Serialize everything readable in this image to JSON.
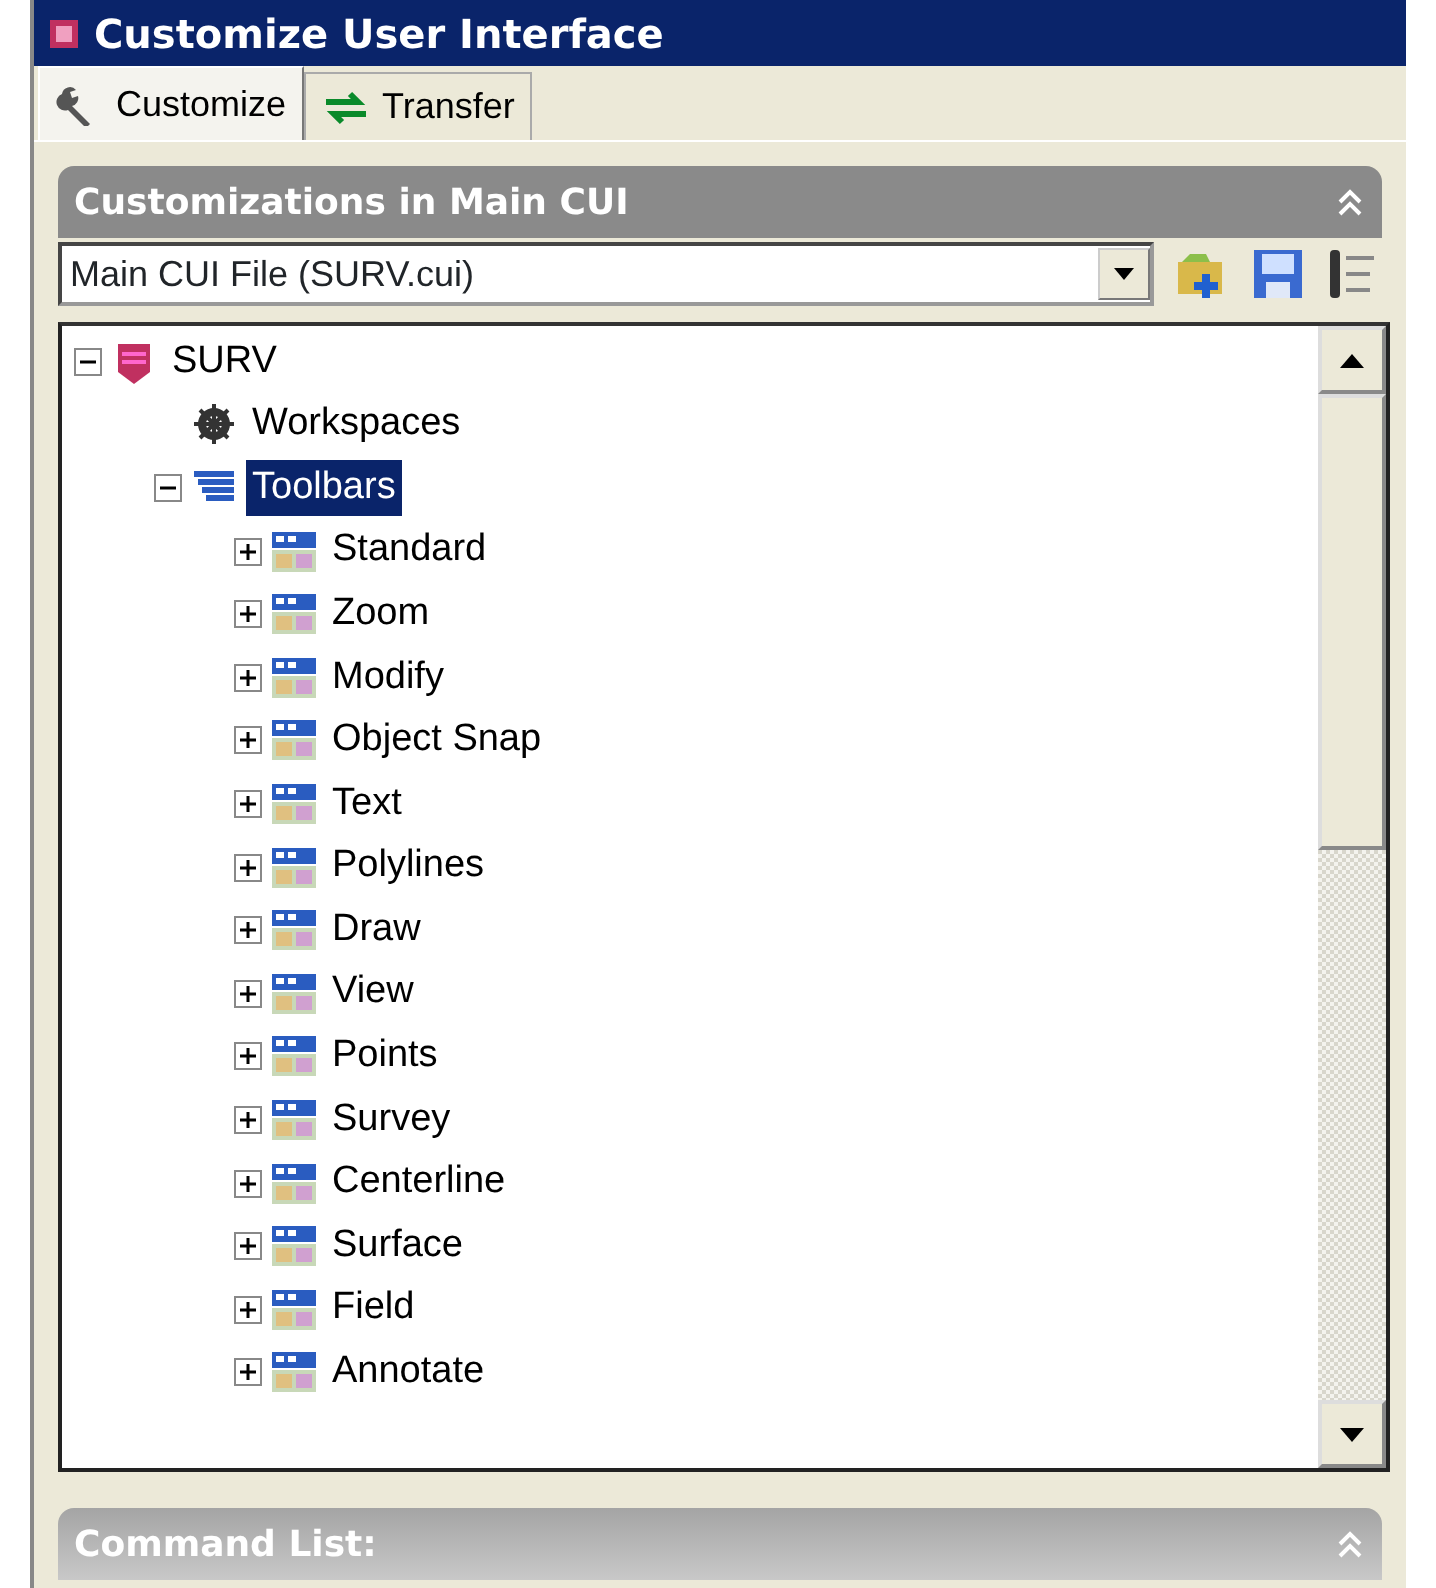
{
  "window": {
    "title": "Customize User Interface"
  },
  "tabs": [
    {
      "label": "Customize",
      "kind": "wrench",
      "selected": true
    },
    {
      "label": "Transfer",
      "kind": "transfer",
      "selected": false
    }
  ],
  "panel": {
    "title": "Customizations in Main CUI",
    "expanded": true
  },
  "file_select": {
    "value": "Main CUI File (SURV.cui)"
  },
  "tree": [
    {
      "label": "SURV",
      "kind": "project",
      "expanded": true,
      "selected": false,
      "children": [
        {
          "label": "Workspaces",
          "kind": "workspace",
          "selected": false
        },
        {
          "label": "Toolbars",
          "kind": "toolbars",
          "expanded": true,
          "selected": true,
          "children": [
            {
              "label": "Standard",
              "kind": "toolbar",
              "expanded": false,
              "selected": false
            },
            {
              "label": "Zoom",
              "kind": "toolbar",
              "expanded": false,
              "selected": false
            },
            {
              "label": "Modify",
              "kind": "toolbar",
              "expanded": false,
              "selected": false
            },
            {
              "label": "Object Snap",
              "kind": "toolbar",
              "expanded": false,
              "selected": false
            },
            {
              "label": "Text",
              "kind": "toolbar",
              "expanded": false,
              "selected": false
            },
            {
              "label": "Polylines",
              "kind": "toolbar",
              "expanded": false,
              "selected": false
            },
            {
              "label": "Draw",
              "kind": "toolbar",
              "expanded": false,
              "selected": false
            },
            {
              "label": "View",
              "kind": "toolbar",
              "expanded": false,
              "selected": false
            },
            {
              "label": "Points",
              "kind": "toolbar",
              "expanded": false,
              "selected": false
            },
            {
              "label": "Survey",
              "kind": "toolbar",
              "expanded": false,
              "selected": false
            },
            {
              "label": "Centerline",
              "kind": "toolbar",
              "expanded": false,
              "selected": false
            },
            {
              "label": "Surface",
              "kind": "toolbar",
              "expanded": false,
              "selected": false
            },
            {
              "label": "Field",
              "kind": "toolbar",
              "expanded": false,
              "selected": false
            },
            {
              "label": "Annotate",
              "kind": "toolbar",
              "expanded": false,
              "selected": false
            }
          ]
        }
      ]
    }
  ],
  "command_panel": {
    "title": "Command List:",
    "expanded": true
  }
}
